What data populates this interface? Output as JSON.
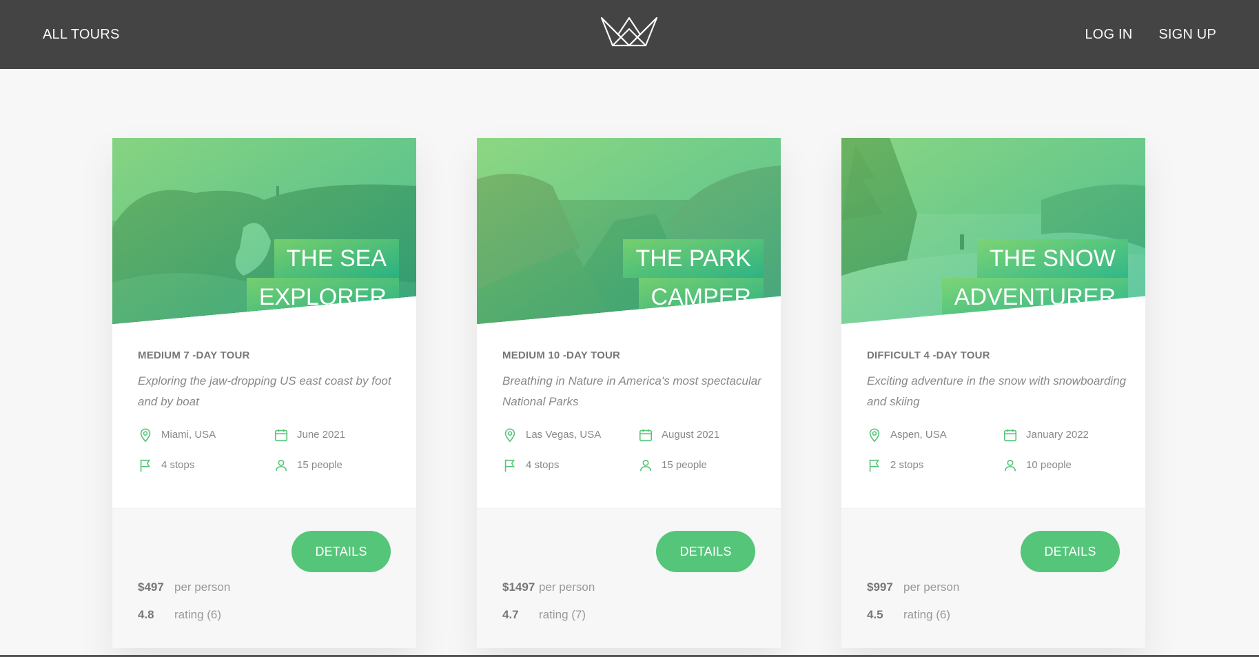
{
  "nav": {
    "all_tours": "ALL TOURS",
    "log_in": "LOG IN",
    "sign_up": "SIGN UP"
  },
  "colors": {
    "header_bg": "#444444",
    "accent_green": "#55c57a",
    "page_bg": "#f7f7f7"
  },
  "cards": [
    {
      "heading_line1": "THE SEA",
      "heading_line2": "EXPLORER",
      "subheading": "MEDIUM 7 -DAY TOUR",
      "description": "Exploring the jaw-dropping US east coast by foot and by boat",
      "location": "Miami, USA",
      "date": "June 2021",
      "stops": "4 stops",
      "people": "15 people",
      "price": "$497",
      "price_label": "per person",
      "rating": "4.8",
      "rating_label": "rating (6)",
      "button": "DETAILS",
      "image_icon": "sea-cliff-photo"
    },
    {
      "heading_line1": "THE PARK",
      "heading_line2": "CAMPER",
      "subheading": "MEDIUM 10 -DAY TOUR",
      "description": "Breathing in Nature in America's most spectacular National Parks",
      "location": "Las Vegas, USA",
      "date": "August 2021",
      "stops": "4 stops",
      "people": "15 people",
      "price": "$1497",
      "price_label": "per person",
      "rating": "4.7",
      "rating_label": "rating (7)",
      "button": "DETAILS",
      "image_icon": "canyon-photo"
    },
    {
      "heading_line1": "THE SNOW",
      "heading_line2": "ADVENTURER",
      "subheading": "DIFFICULT 4 -DAY TOUR",
      "description": "Exciting adventure in the snow with snowboarding and skiing",
      "location": "Aspen, USA",
      "date": "January 2022",
      "stops": "2 stops",
      "people": "10 people",
      "price": "$997",
      "price_label": "per person",
      "rating": "4.5",
      "rating_label": "rating (6)",
      "button": "DETAILS",
      "image_icon": "snow-mountain-photo"
    }
  ]
}
